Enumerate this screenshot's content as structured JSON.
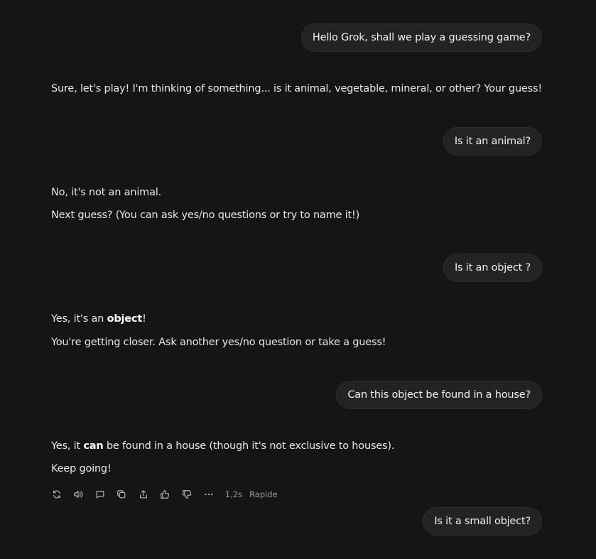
{
  "conversation": {
    "user_1": "Hello Grok, shall we play a guessing game?",
    "reply_1": {
      "line_1": "Sure, let's play! I'm thinking of something... is it animal, vegetable, mineral, or other? Your guess!"
    },
    "user_2": "Is it an animal?",
    "reply_2": {
      "line_1": "No, it's not an animal.",
      "line_2": "Next guess? (You can ask yes/no questions or try to name it!)"
    },
    "user_3": "Is it an object ?",
    "reply_3": {
      "line_1_pre": "Yes, it's an ",
      "line_1_bold": "object",
      "line_1_post": "!",
      "line_2": "You're getting closer. Ask another yes/no question or take a guess!"
    },
    "user_4": "Can this object be found in a house?",
    "reply_4": {
      "line_1_pre": "Yes, it ",
      "line_1_bold": "can",
      "line_1_post": " be found in a house (though it's not exclusive to houses).",
      "line_2": "Keep going!"
    },
    "user_5": "Is it a small object?"
  },
  "action_bar": {
    "icons": [
      "regenerate-icon",
      "speaker-icon",
      "comment-icon",
      "copy-icon",
      "share-icon",
      "thumbs-up-icon",
      "thumbs-down-icon",
      "more-icon"
    ],
    "response_time": "1,2s",
    "mode": "Rapide"
  },
  "colors": {
    "background": "#151515",
    "bubble": "#232323",
    "text": "#ececec",
    "muted": "#9a9a9a"
  }
}
